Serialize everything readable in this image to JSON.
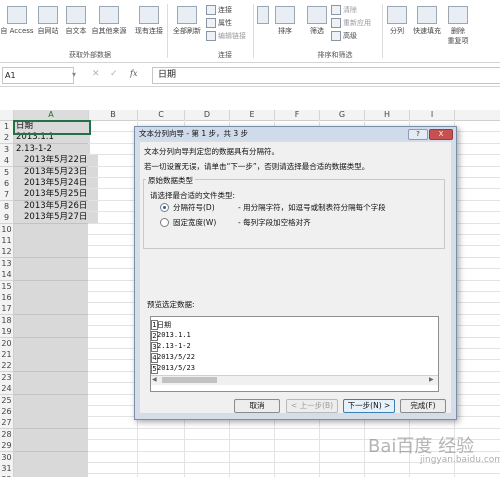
{
  "ribbon": {
    "buttons": [
      {
        "label": "自 Access",
        "icon": "access-icon"
      },
      {
        "label": "自网站",
        "icon": "web-icon"
      },
      {
        "label": "自文本",
        "icon": "text-file-icon"
      },
      {
        "label": "自其他来源",
        "icon": "other-source-icon"
      },
      {
        "label": "现有连接",
        "icon": "connection-icon"
      },
      {
        "label": "全部刷新",
        "icon": "refresh-icon"
      }
    ],
    "small_items": [
      "连接",
      "属性",
      "编辑链接"
    ],
    "sort_label": "排序",
    "filter_label": "筛选",
    "filter_items": [
      "清除",
      "重新应用",
      "高级"
    ],
    "tools": [
      {
        "label": "分列",
        "icon": "text-to-columns-icon"
      },
      {
        "label": "快速填充",
        "icon": "flash-fill-icon"
      },
      {
        "label": "删除",
        "label2": "重复项",
        "icon": "remove-duplicates-icon"
      }
    ],
    "groups": [
      "获取外部数据",
      "连接",
      "排序和筛选"
    ]
  },
  "formula_bar": {
    "name_box": "A1",
    "fx": "fx",
    "content": "日期"
  },
  "columns": [
    "A",
    "B",
    "C",
    "D",
    "E",
    "F",
    "G",
    "H",
    "I"
  ],
  "rows": [
    "1",
    "2",
    "3",
    "4",
    "5",
    "6",
    "7",
    "8",
    "9",
    "10",
    "11",
    "12",
    "13",
    "14",
    "15",
    "16",
    "17",
    "18",
    "19",
    "20",
    "21",
    "22",
    "23",
    "24",
    "25",
    "26",
    "27",
    "28",
    "29",
    "30",
    "31",
    "32",
    "33"
  ],
  "cells_a": [
    "日期",
    "2013.1.1",
    "2.13-1-2",
    "2013年5月22日",
    "2013年5月23日",
    "2013年5月24日",
    "2013年5月25日",
    "2013年5月26日",
    "2013年5月27日"
  ],
  "dialog": {
    "title": "文本分列向导 - 第 1 步，共 3 步",
    "help_btn": "?",
    "close_btn": "X",
    "intro1": "文本分列向导判定您的数据具有分隔符。",
    "intro2": "若一切设置无误，请单击“下一步”，否则请选择最合适的数据类型。",
    "group_title": "原始数据类型",
    "choose_label": "请选择最合适的文件类型:",
    "option1": "分隔符号(D)",
    "option1_desc": "- 用分隔字符，如逗号或制表符分隔每个字段",
    "option2": "固定宽度(W)",
    "option2_desc": "- 每列字段加空格对齐",
    "preview_label": "预览选定数据:",
    "preview_lines": [
      {
        "n": "1",
        "text": "日期"
      },
      {
        "n": "2",
        "text": "2013.1.1"
      },
      {
        "n": "3",
        "text": "2.13-1-2"
      },
      {
        "n": "4",
        "text": "2013/5/22"
      },
      {
        "n": "5",
        "text": "2013/5/23"
      }
    ],
    "btn_cancel": "取消",
    "btn_back": "< 上一步(B)",
    "btn_next": "下一步(N) >",
    "btn_finish": "完成(F)"
  },
  "watermark": "Bai百度 经验",
  "watermark_sub": "jingyan.baidu.com"
}
